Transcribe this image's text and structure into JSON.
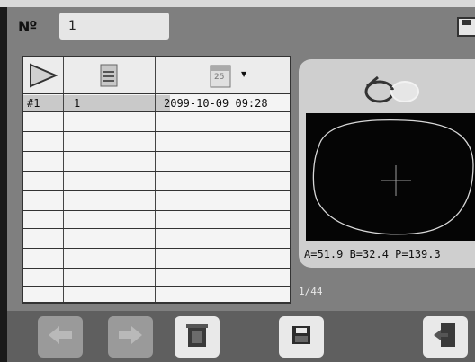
{
  "header": {
    "job_label": "Nº",
    "job_number": "1"
  },
  "table": {
    "rows": [
      {
        "index": "#1",
        "job": "1",
        "date": "2099-10-09 09:28"
      }
    ],
    "date_icon_text": "25"
  },
  "lens": {
    "measurement": "A=51.9 B=32.4 P=139.3"
  },
  "pagination": {
    "page": "1/44"
  },
  "colors": {
    "bezel": "#1a1a1a",
    "screen_bg": "#7f7f7f",
    "table_bg": "#f4f4f4",
    "lens_bg": "#050505",
    "lens_outline": "#d8d8d8"
  }
}
